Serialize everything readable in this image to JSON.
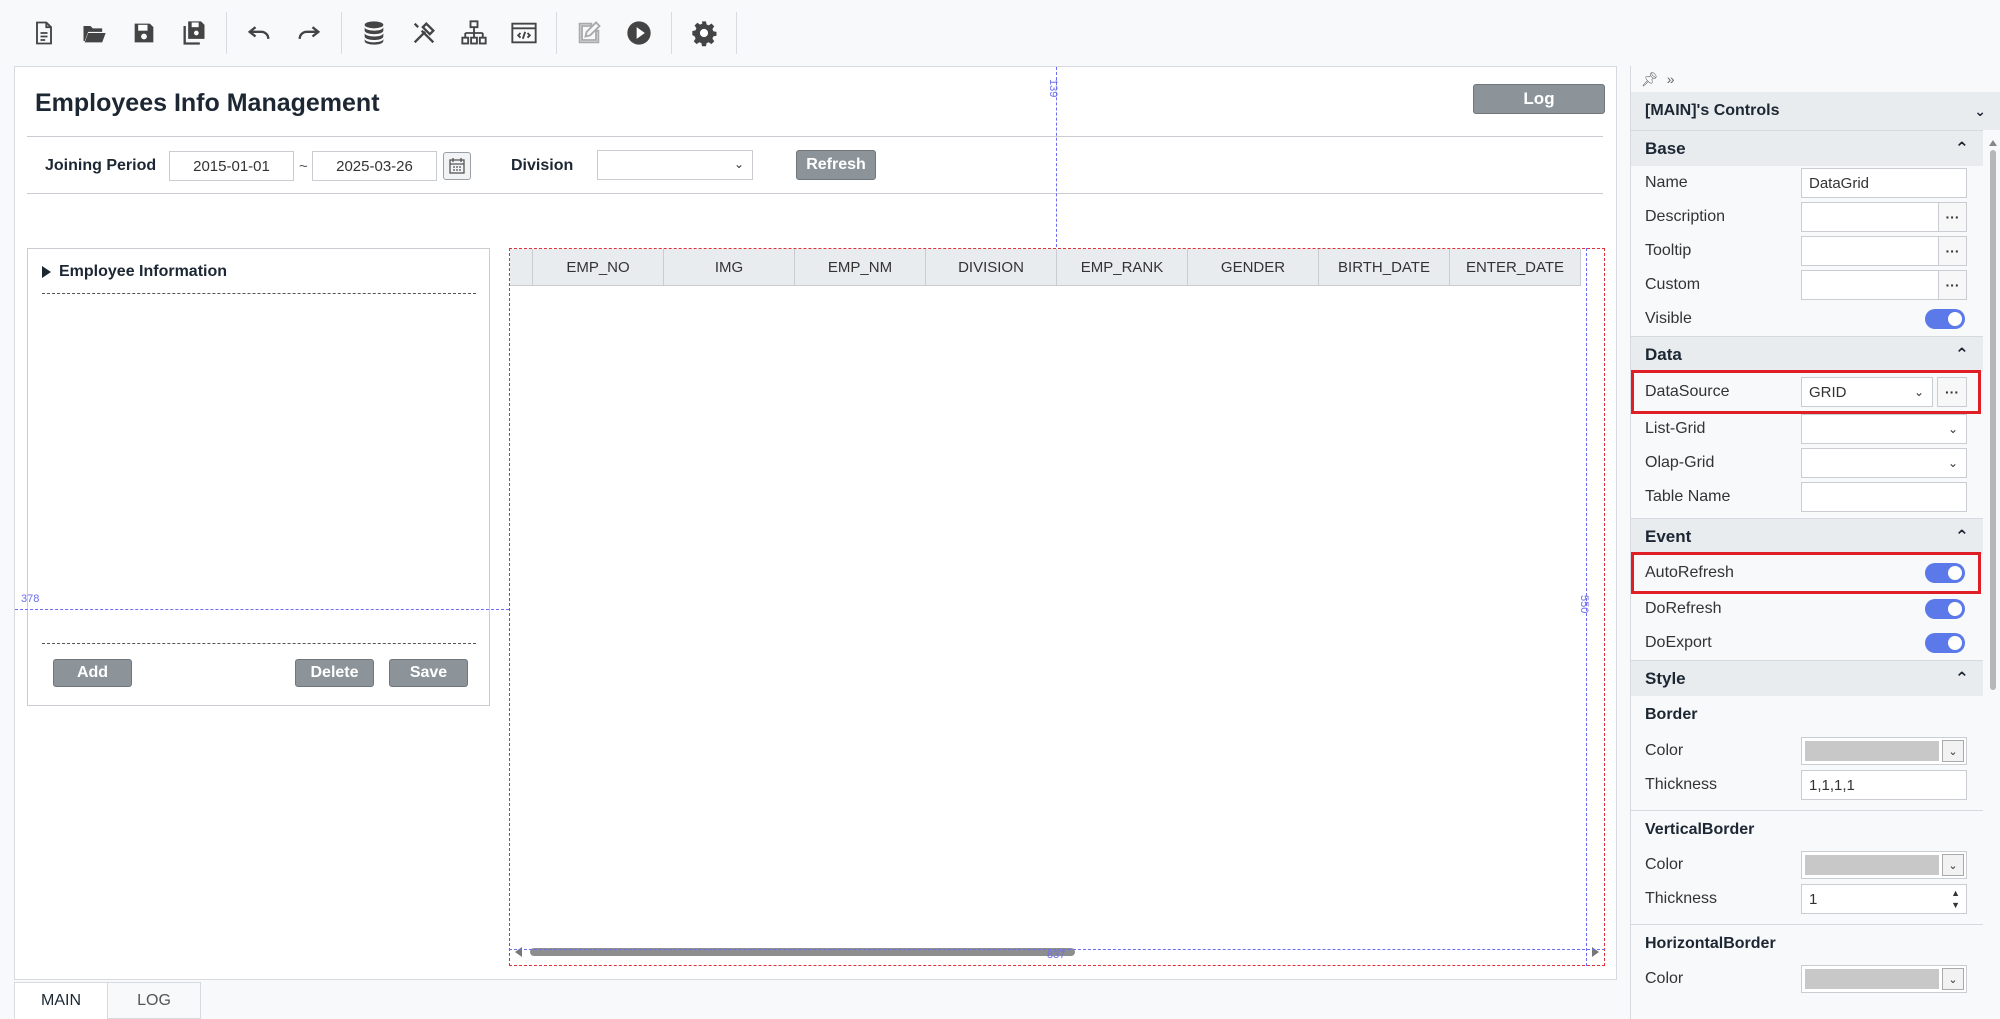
{
  "toolbar": {
    "icons": [
      "new-file-icon",
      "open-folder-icon",
      "save-icon",
      "save-all-icon",
      "undo-icon",
      "redo-icon",
      "database-icon",
      "tools-icon",
      "hierarchy-icon",
      "code-window-icon",
      "edit-icon",
      "run-icon",
      "settings-icon"
    ]
  },
  "canvas": {
    "title": "Employees Info Management",
    "log_label": "Log",
    "joining_period_label": "Joining Period",
    "date_from": "2015-01-01",
    "date_sep": "~",
    "date_to": "2025-03-26",
    "division_label": "Division",
    "division_value": "",
    "refresh_label": "Refresh",
    "section_title": "Employee Information",
    "add_label": "Add",
    "delete_label": "Delete",
    "save_label": "Save",
    "grid_columns": [
      "EMP_NO",
      "IMG",
      "EMP_NM",
      "DIVISION",
      "EMP_RANK",
      "GENDER",
      "BIRTH_DATE",
      "ENTER_DATE"
    ],
    "guides": {
      "top": "139",
      "left": "378",
      "right": "550",
      "bottom": "837"
    }
  },
  "tabs": [
    "MAIN",
    "LOG"
  ],
  "props": {
    "title": "[MAIN]'s Controls",
    "sections": {
      "base": "Base",
      "data": "Data",
      "event": "Event",
      "style": "Style"
    },
    "base": {
      "name_label": "Name",
      "name_value": "DataGrid",
      "description_label": "Description",
      "tooltip_label": "Tooltip",
      "custom_label": "Custom",
      "visible_label": "Visible"
    },
    "data": {
      "datasource_label": "DataSource",
      "datasource_value": "GRID",
      "listgrid_label": "List-Grid",
      "olapgrid_label": "Olap-Grid",
      "tablename_label": "Table Name"
    },
    "event": {
      "autorefresh_label": "AutoRefresh",
      "dorefresh_label": "DoRefresh",
      "doexport_label": "DoExport"
    },
    "style": {
      "border_label": "Border",
      "border_color_label": "Color",
      "border_thickness_label": "Thickness",
      "border_thickness_value": "1,1,1,1",
      "vborder_label": "VerticalBorder",
      "vborder_color_label": "Color",
      "vborder_thickness_label": "Thickness",
      "vborder_thickness_value": "1",
      "hborder_label": "HorizontalBorder",
      "hborder_color_label": "Color"
    },
    "colors": {
      "accent_toggle": "#5b79e8",
      "highlight": "#e01e26",
      "swatch": "#c8c8c8"
    }
  }
}
